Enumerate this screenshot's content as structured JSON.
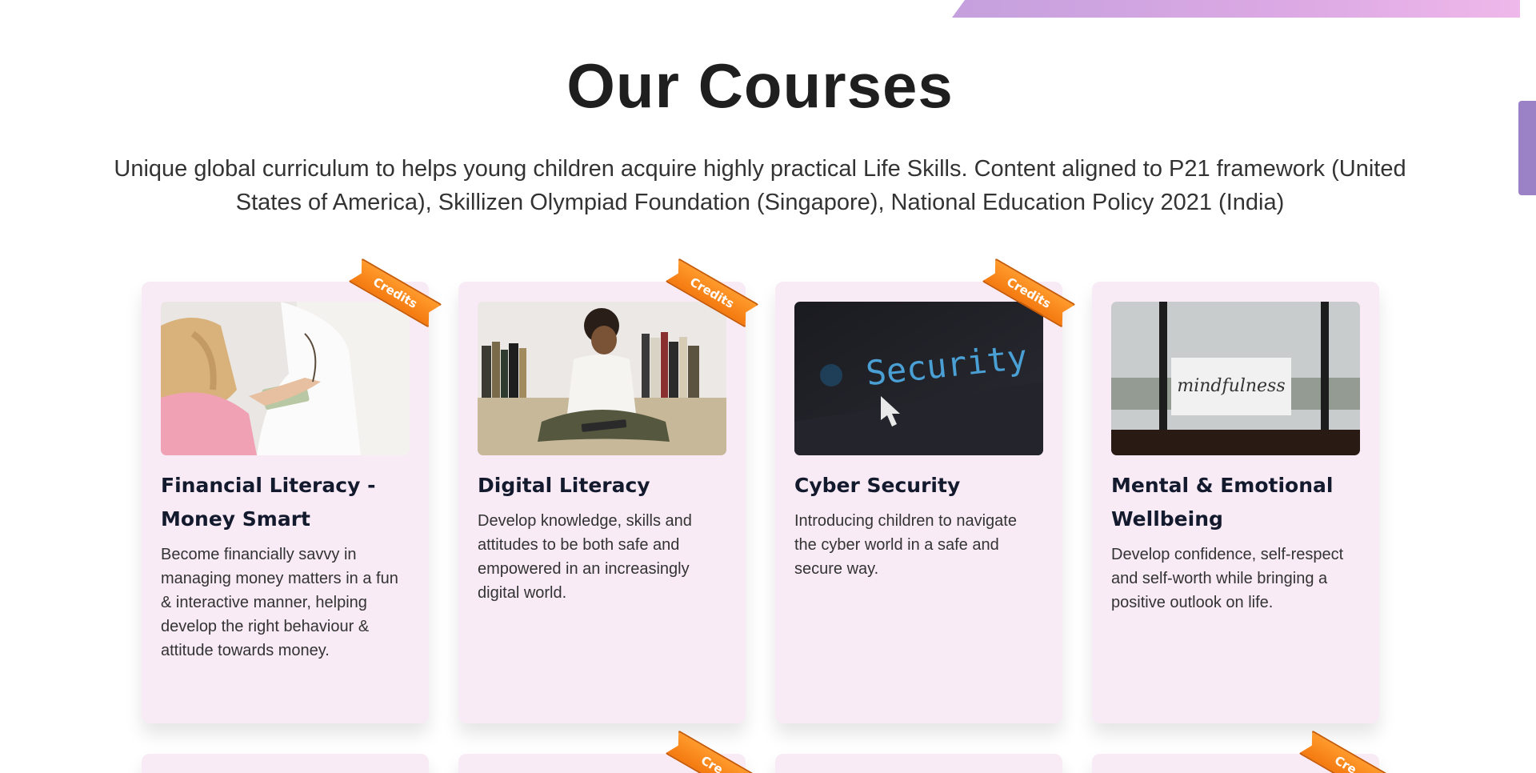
{
  "section": {
    "title": "Our Courses",
    "subtitle": "Unique global curriculum to helps young children acquire highly practical Life Skills. Content aligned to P21 framework (United States of America), Skillizen Olympiad Foundation (Singapore), National Education Policy 2021 (India)"
  },
  "courses": [
    {
      "title": "Financial Literacy - Money Smart",
      "description": "Become financially savvy in managing money matters in a fun & interactive manner, helping develop the right behaviour & attitude towards money.",
      "badge": "Credits",
      "image": "child-money-photo"
    },
    {
      "title": "Digital Literacy",
      "description": "Develop knowledge, skills and attitudes to be both safe and empowered in an increasingly digital world.",
      "badge": "Credits",
      "image": "child-tablet-photo"
    },
    {
      "title": "Cyber Security",
      "description": "Introducing children to navigate the cyber world in a safe and secure way.",
      "badge": "Credits",
      "image": "security-screen-photo",
      "image_text": "Security"
    },
    {
      "title": "Mental & Emotional Wellbeing",
      "description": "Develop confidence, self-respect and self-worth while bringing a positive outlook on life.",
      "image": "mindfulness-card-photo",
      "image_text": "mindfulness"
    }
  ],
  "second_row_badges": [
    "Cre",
    "",
    "",
    "Cre"
  ],
  "colors": {
    "card_bg": "#f8ebf5",
    "badge": "#f47a10",
    "accent_tab": "#9b82c6"
  }
}
